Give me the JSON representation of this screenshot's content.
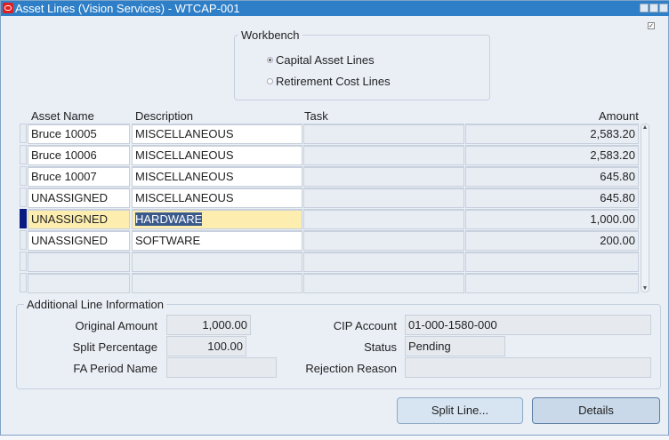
{
  "window": {
    "title": "Asset Lines (Vision Services) - WTCAP-001"
  },
  "workbench": {
    "legend": "Workbench",
    "options": [
      {
        "label": "Capital Asset Lines",
        "selected": true
      },
      {
        "label": "Retirement Cost Lines",
        "selected": false
      }
    ]
  },
  "table": {
    "headers": {
      "asset_name": "Asset Name",
      "description": "Description",
      "task": "Task",
      "amount": "Amount"
    },
    "rows": [
      {
        "asset_name": "Bruce 10005",
        "description": "MISCELLANEOUS",
        "task": "",
        "amount": "2,583.20"
      },
      {
        "asset_name": "Bruce 10006",
        "description": "MISCELLANEOUS",
        "task": "",
        "amount": "2,583.20"
      },
      {
        "asset_name": "Bruce 10007",
        "description": "MISCELLANEOUS",
        "task": "",
        "amount": "645.80"
      },
      {
        "asset_name": "UNASSIGNED",
        "description": "MISCELLANEOUS",
        "task": "",
        "amount": "645.80"
      },
      {
        "asset_name": "UNASSIGNED",
        "description": "HARDWARE",
        "task": "",
        "amount": "1,000.00"
      },
      {
        "asset_name": "UNASSIGNED",
        "description": "SOFTWARE",
        "task": "",
        "amount": "200.00"
      }
    ]
  },
  "additional": {
    "legend": "Additional Line Information",
    "original_amount_label": "Original Amount",
    "original_amount": "1,000.00",
    "split_percentage_label": "Split Percentage",
    "split_percentage": "100.00",
    "fa_period_label": "FA Period Name",
    "fa_period": "",
    "cip_account_label": "CIP Account",
    "cip_account": "01-000-1580-000",
    "status_label": "Status",
    "status": "Pending",
    "rejection_label": "Rejection Reason",
    "rejection": ""
  },
  "buttons": {
    "split": "Split Line...",
    "details": "Details"
  }
}
